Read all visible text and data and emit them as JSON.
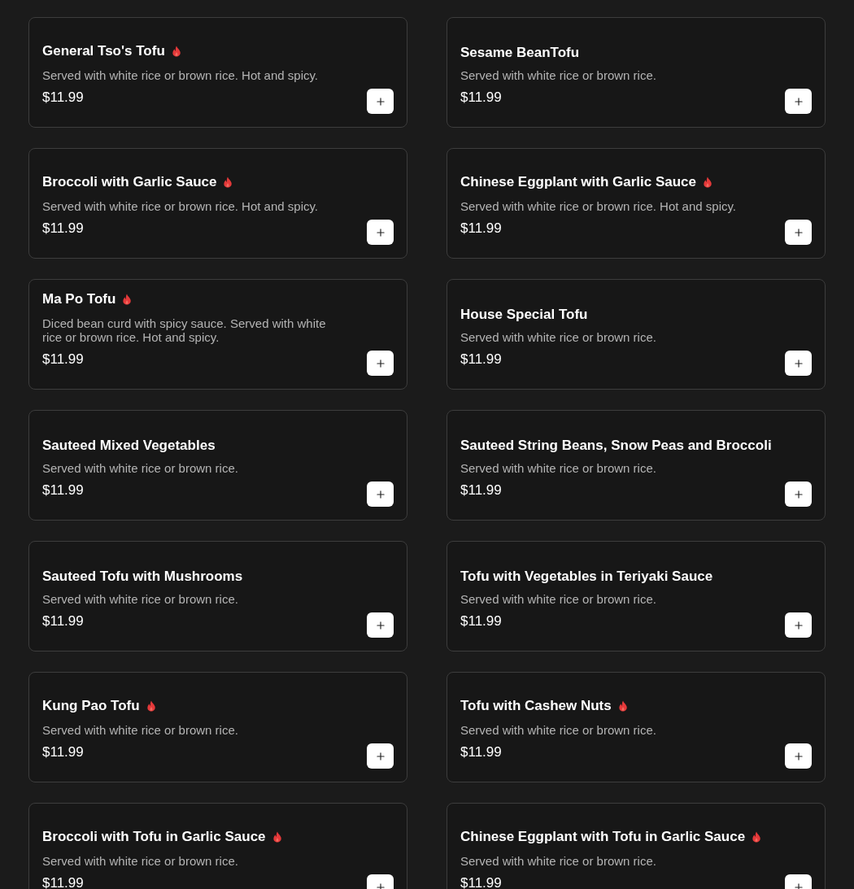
{
  "menu_items": [
    {
      "name": "General Tso's Tofu",
      "spicy": true,
      "description": "Served with white rice or brown rice. Hot and spicy.",
      "price": "$11.99"
    },
    {
      "name": "Sesame BeanTofu",
      "spicy": false,
      "description": "Served with white rice or brown rice.",
      "price": "$11.99"
    },
    {
      "name": "Broccoli with Garlic Sauce",
      "spicy": true,
      "description": "Served with white rice or brown rice. Hot and spicy.",
      "price": "$11.99"
    },
    {
      "name": "Chinese Eggplant with Garlic Sauce",
      "spicy": true,
      "description": "Served with white rice or brown rice. Hot and spicy.",
      "price": "$11.99"
    },
    {
      "name": "Ma Po Tofu",
      "spicy": true,
      "description": "Diced bean curd with spicy sauce. Served with white rice or brown rice. Hot and spicy.",
      "price": "$11.99"
    },
    {
      "name": "House Special Tofu",
      "spicy": false,
      "description": "Served with white rice or brown rice.",
      "price": "$11.99"
    },
    {
      "name": "Sauteed Mixed Vegetables",
      "spicy": false,
      "description": "Served with white rice or brown rice.",
      "price": "$11.99"
    },
    {
      "name": "Sauteed String Beans, Snow Peas and Broccoli",
      "spicy": false,
      "description": "Served with white rice or brown rice.",
      "price": "$11.99"
    },
    {
      "name": "Sauteed Tofu with Mushrooms",
      "spicy": false,
      "description": "Served with white rice or brown rice.",
      "price": "$11.99"
    },
    {
      "name": "Tofu with Vegetables in Teriyaki Sauce",
      "spicy": false,
      "description": "Served with white rice or brown rice.",
      "price": "$11.99"
    },
    {
      "name": "Kung Pao Tofu",
      "spicy": true,
      "description": "Served with white rice or brown rice.",
      "price": "$11.99"
    },
    {
      "name": "Tofu with Cashew Nuts",
      "spicy": true,
      "description": "Served with white rice or brown rice.",
      "price": "$11.99"
    },
    {
      "name": "Broccoli with Tofu in Garlic Sauce",
      "spicy": true,
      "description": "Served with white rice or brown rice.",
      "price": "$11.99"
    },
    {
      "name": "Chinese Eggplant with Tofu in Garlic Sauce",
      "spicy": true,
      "description": "Served with white rice or brown rice.",
      "price": "$11.99"
    }
  ]
}
